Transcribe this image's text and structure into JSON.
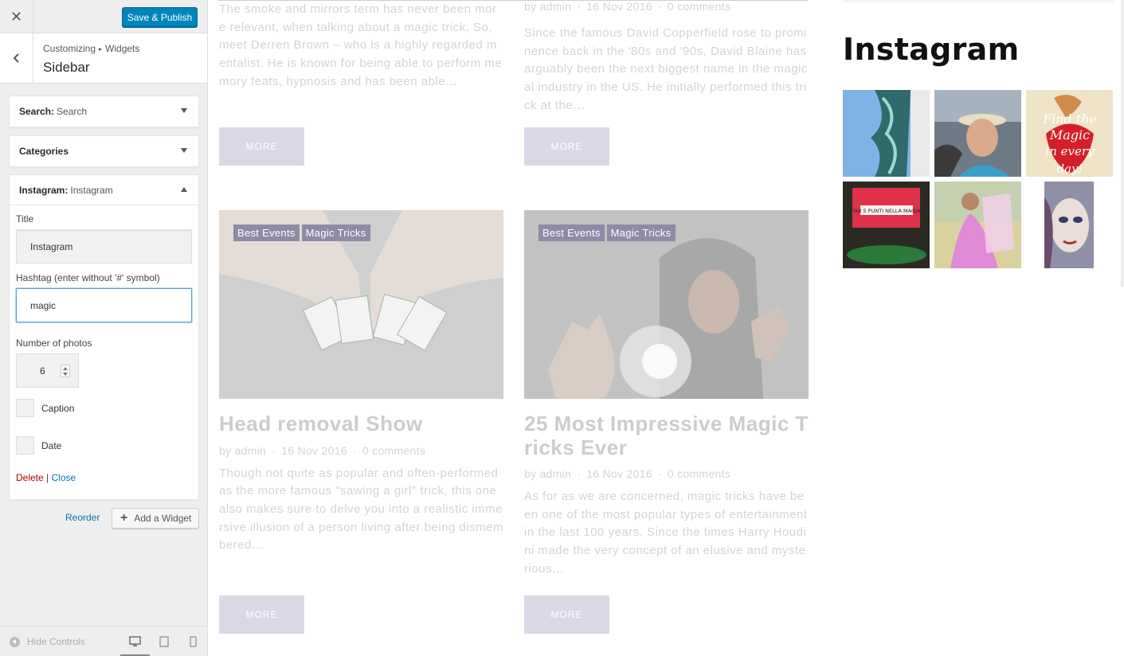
{
  "customizer": {
    "publish_label": "Save & Publish",
    "close_glyph": "✕",
    "breadcrumb": {
      "root": "Customizing",
      "separator": "▸",
      "parent": "Widgets"
    },
    "section_title": "Sidebar",
    "widgets": [
      {
        "type": "Search:",
        "name": "Search"
      },
      {
        "type": "Categories",
        "name": ""
      },
      {
        "type": "Instagram:",
        "name": "Instagram"
      }
    ],
    "instagram_form": {
      "title_label": "Title",
      "title_value": "Instagram",
      "hashtag_label": "Hashtag (enter without '#' symbol)",
      "hashtag_value": "magic",
      "photos_label": "Number of photos",
      "photos_value": "6",
      "caption_label": "Caption",
      "date_label": "Date",
      "delete_label": "Delete",
      "actions_sep": "|",
      "close_label": "Close"
    },
    "reorder_label": "Reorder",
    "add_widget_label": "Add a Widget",
    "hide_controls_label": "Hide Controls"
  },
  "preview": {
    "posts_top": [
      {
        "excerpt": "The smoke and mirrors term has never been more relevant, when talking about a magic trick. So, meet Derren Brown – who is a highly regarded mentalist. He is known for being able to perform memory feats, hypnosis and has been able…",
        "more": "MORE"
      },
      {
        "meta": {
          "by": "by",
          "author": "admin",
          "date": "16 Nov 2016",
          "comments": "0 comments"
        },
        "excerpt": "Since the famous David Copperfield rose to prominence back in the '80s and '90s, David Blaine has arguably been the next biggest name in the magical industry in the US. He initially performed this trick at the…",
        "more": "MORE"
      }
    ],
    "posts_bottom": [
      {
        "categories": [
          "Best Events",
          "Magic Tricks"
        ],
        "title": "Head removal Show",
        "meta": {
          "by": "by",
          "author": "admin",
          "date": "16 Nov 2016",
          "comments": "0 comments"
        },
        "excerpt": "Though not quite as popular and often-performed as the more famous \"sawing a girl\" trick, this one also makes sure to delve you into a realistic immersive illusion of a person living after being dismembered…",
        "more": "MORE"
      },
      {
        "categories": [
          "Best Events",
          "Magic Tricks"
        ],
        "title": "25 Most Impressive Magic Tricks Ever",
        "meta": {
          "by": "by",
          "author": "admin",
          "date": "16 Nov 2016",
          "comments": "0 comments"
        },
        "excerpt": "As for as we are concerned, magic tricks have been one of the most popular types of entertainment in the last 100 years. Since the times Harry Houdini made the very concept of an elusive and mysterious…",
        "more": "MORE"
      }
    ],
    "instagram": {
      "title": "Instagram",
      "photos": [
        {
          "caption_text": ""
        },
        {
          "caption_text": ""
        },
        {
          "caption_text": "Find the Magic in every day!"
        },
        {
          "caption_text": "SUI 5 PUNTI NELLA MAGIA"
        },
        {
          "caption_text": ""
        },
        {
          "caption_text": ""
        }
      ]
    }
  },
  "colors": {
    "publish_blue": "#0085ba",
    "link_blue": "#0073aa",
    "delete_red": "#aa0000",
    "more_button": "#a9a4c4"
  }
}
